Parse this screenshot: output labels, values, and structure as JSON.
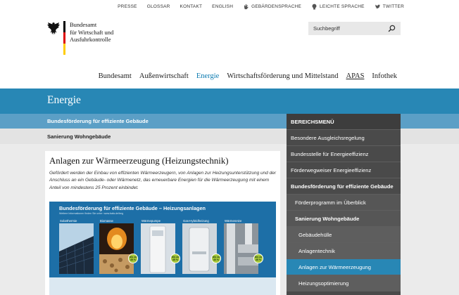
{
  "topbar": {
    "items": [
      "PRESSE",
      "GLOSSAR",
      "KONTAKT",
      "ENGLISH",
      "GEBÄRDENSPRACHE",
      "LEICHTE SPRACHE",
      "TWITTER"
    ]
  },
  "logo": {
    "line1": "Bundesamt",
    "line2": "für Wirtschaft und",
    "line3": "Ausfuhrkontrolle",
    "flag_colors": [
      "#000000",
      "#dd0000",
      "#ffcc00"
    ]
  },
  "search": {
    "placeholder": "Suchbegriff"
  },
  "mainnav": {
    "items": [
      "Bundesamt",
      "Außenwirtschaft",
      "Energie",
      "Wirtschaftsförderung und Mittelstand",
      "APAS",
      "Infothek"
    ],
    "active": "Energie"
  },
  "section": {
    "title": "Energie"
  },
  "breadcrumb": {
    "level1": "Bundesförderung für effiziente Gebäude",
    "level2": "Sanierung Wohngebäude"
  },
  "article": {
    "title": "Anlagen zur Wärmeerzeugung (Heizungstechnik)",
    "intro": "Gefördert werden der Einbau von effizienten Wärmeerzeugern, von Anlagen zur Heizungsunterstützung und der Anschluss an ein Gebäude- oder Wärmenetz, das erneuerbare Energien für die Wärmeerzeugung mit einem Anteil von mindestens 25 Prozent einbindet.",
    "infographic": {
      "title": "Bundesförderung für effiziente Gebäude – Heizungsanlagen",
      "subtitle": "Weitere Informationen finden Sie unter: www.bafa.de/beg",
      "panels": [
        {
          "label": "Solarthermie",
          "badge_top": "",
          "badge_value": "35 %"
        },
        {
          "label": "Biomasse",
          "badge_top": "bis zu",
          "badge_value": "45 %"
        },
        {
          "label": "Wärmepumpe",
          "badge_top": "bis zu",
          "badge_value": "45 %"
        },
        {
          "label": "Gas-Hybridheizung",
          "badge_top": "bis zu",
          "badge_value": "40 %"
        },
        {
          "label": "Wärmenetze",
          "badge_top": "bis zu",
          "badge_value": "45 %"
        }
      ]
    }
  },
  "sidebar": {
    "header": "BEREICHSMENÜ",
    "items": [
      {
        "label": "Besondere Ausgleichsregelung",
        "level": 1
      },
      {
        "label": "Bundesstelle für Energieeffizienz",
        "level": 1
      },
      {
        "label": "Förderwegweiser Energieeffizienz",
        "level": 1
      },
      {
        "label": "Bundesförderung für effiziente Gebäude",
        "level": 1
      },
      {
        "label": "Förderprogramm im Überblick",
        "level": 2
      },
      {
        "label": "Sanierung Wohngebäude",
        "level": 2
      },
      {
        "label": "Gebäudehülle",
        "level": 3
      },
      {
        "label": "Anlagentechnik",
        "level": 3
      },
      {
        "label": "Anlagen zur Wärmeerzeugung",
        "level": 3
      },
      {
        "label": "Heizungsoptimierung",
        "level": 3
      }
    ],
    "accent_color": "#2887b5"
  }
}
